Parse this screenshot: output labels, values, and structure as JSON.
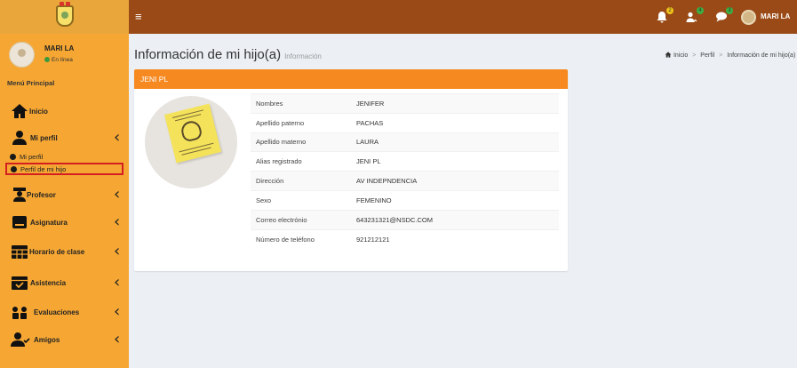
{
  "topbar": {
    "menu_glyph": "≡",
    "notifications": [
      {
        "icon": "bell-icon",
        "badge": "2",
        "badge_color": "#f0c419"
      },
      {
        "icon": "users-icon",
        "badge": "4",
        "badge_color": "#3cb043"
      },
      {
        "icon": "chat-icon",
        "badge": "3",
        "badge_color": "#3cb043"
      }
    ],
    "username": "MARI LA"
  },
  "sidebar": {
    "user": {
      "name": "MARI LA",
      "status": "En línea"
    },
    "menu_header": "Menú Principal",
    "items": [
      {
        "label": "Inicio",
        "icon": "home-icon",
        "chevron": ""
      },
      {
        "label": "Mi perfil",
        "icon": "user-icon",
        "chevron": "‹"
      },
      {
        "label": "Profesor",
        "icon": "teacher-icon",
        "chevron": "‹"
      },
      {
        "label": "Asignatura",
        "icon": "book-icon",
        "chevron": "‹"
      },
      {
        "label": "Horario de clase",
        "icon": "calendar-icon",
        "chevron": "‹"
      },
      {
        "label": "Asistencia",
        "icon": "calendar-check-icon",
        "chevron": "‹"
      },
      {
        "label": "Evaluaciones",
        "icon": "group-icon",
        "chevron": "‹"
      },
      {
        "label": "Amigos",
        "icon": "user-check-icon",
        "chevron": "‹"
      }
    ],
    "subitems": [
      {
        "label": "Mi perfil"
      },
      {
        "label": "Perfil de mi hijo"
      }
    ]
  },
  "page": {
    "title": "Información de mi hijo(a)",
    "subtitle": "Información",
    "breadcrumb": [
      "Inicio",
      "Perfil",
      "Información de mi hijo(a)"
    ]
  },
  "card": {
    "header": "JENI PL",
    "rows": [
      {
        "key": "Nombres",
        "value": "JENIFER"
      },
      {
        "key": "Apellido paterno",
        "value": "PACHAS"
      },
      {
        "key": "Apellido materno",
        "value": "LAURA"
      },
      {
        "key": "Alias registrado",
        "value": "JENI PL"
      },
      {
        "key": "Dirección",
        "value": "AV INDEPNDENCIA"
      },
      {
        "key": "Sexo",
        "value": "FEMENINO"
      },
      {
        "key": "Correo electrónio",
        "value": "643231321@NSDC.COM"
      },
      {
        "key": "Número de teléfono",
        "value": "921212121"
      }
    ]
  },
  "colors": {
    "topbar": "#9a4a16",
    "sidebar": "#f6a733",
    "card_header": "#f6891f",
    "highlight_border": "#d31f1f"
  }
}
